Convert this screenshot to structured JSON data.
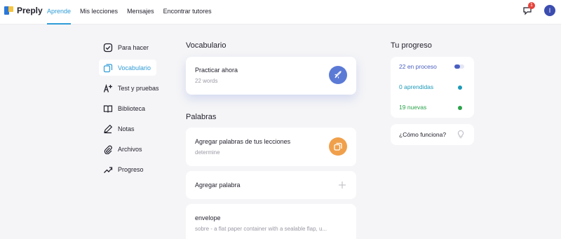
{
  "header": {
    "brand": "Preply",
    "nav": [
      "Aprende",
      "Mis lecciones",
      "Mensajes",
      "Encontrar tutores"
    ],
    "notifications": "1",
    "avatar_initial": "I"
  },
  "sidebar": {
    "items": [
      {
        "label": "Para hacer",
        "icon": "checkbox-icon"
      },
      {
        "label": "Vocabulario",
        "icon": "cards-icon"
      },
      {
        "label": "Test y pruebas",
        "icon": "quiz-icon"
      },
      {
        "label": "Biblioteca",
        "icon": "book-icon"
      },
      {
        "label": "Notas",
        "icon": "pencil-icon"
      },
      {
        "label": "Archivos",
        "icon": "paperclip-icon"
      },
      {
        "label": "Progreso",
        "icon": "trend-up-icon"
      }
    ]
  },
  "vocab": {
    "title": "Vocabulario",
    "practice_title": "Practicar ahora",
    "practice_count": "22 words"
  },
  "words": {
    "title": "Palabras",
    "add_from_lessons": "Agregar palabras de tus lecciones",
    "add_from_lessons_sub": "determine",
    "add_word": "Agregar palabra",
    "entry_word": "envelope",
    "entry_def": "sobre - a flat paper container with a sealable flap, u..."
  },
  "progress": {
    "title": "Tu progreso",
    "in_process": "22 en proceso",
    "learned": "0 aprendidas",
    "new": "19 nuevas",
    "how_it_works": "¿Cómo funciona?"
  },
  "colors": {
    "accent": "#2f9bd6",
    "practice_button": "#5b7ad6",
    "add_button": "#f0a04b",
    "in_process": "#4a5fc1",
    "learned": "#1e9ab8",
    "new": "#2aa24a"
  }
}
